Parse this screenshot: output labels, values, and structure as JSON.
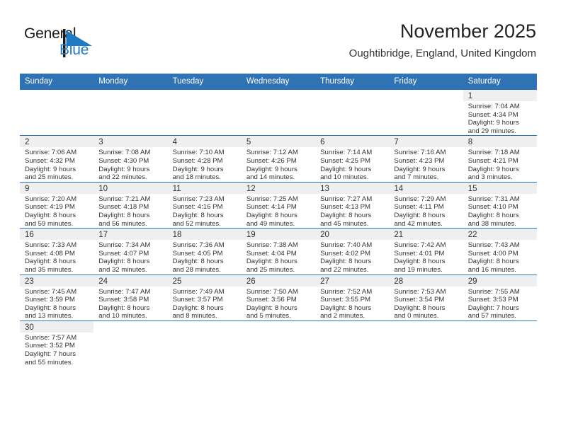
{
  "brand": {
    "name_part1": "General",
    "name_part2": "Blue",
    "logo_icon": "triangle-flag-icon",
    "accent_color": "#1f7ac4"
  },
  "header": {
    "title": "November 2025",
    "subtitle": "Oughtibridge, England, United Kingdom"
  },
  "theme": {
    "header_bg": "#2f73b5",
    "daynum_bg": "#efefef",
    "row_divider": "#2f73b5",
    "text": "#333333"
  },
  "weekday_headers": [
    "Sunday",
    "Monday",
    "Tuesday",
    "Wednesday",
    "Thursday",
    "Friday",
    "Saturday"
  ],
  "labels": {
    "sunrise_prefix": "Sunrise:",
    "sunset_prefix": "Sunset:",
    "daylight_prefix": "Daylight:"
  },
  "weeks": [
    [
      {
        "day": "",
        "blank": true
      },
      {
        "day": "",
        "blank": true
      },
      {
        "day": "",
        "blank": true
      },
      {
        "day": "",
        "blank": true
      },
      {
        "day": "",
        "blank": true
      },
      {
        "day": "",
        "blank": true
      },
      {
        "day": "1",
        "sunrise": "Sunrise: 7:04 AM",
        "sunset": "Sunset: 4:34 PM",
        "daylight_line1": "Daylight: 9 hours",
        "daylight_line2": "and 29 minutes."
      }
    ],
    [
      {
        "day": "2",
        "sunrise": "Sunrise: 7:06 AM",
        "sunset": "Sunset: 4:32 PM",
        "daylight_line1": "Daylight: 9 hours",
        "daylight_line2": "and 25 minutes."
      },
      {
        "day": "3",
        "sunrise": "Sunrise: 7:08 AM",
        "sunset": "Sunset: 4:30 PM",
        "daylight_line1": "Daylight: 9 hours",
        "daylight_line2": "and 22 minutes."
      },
      {
        "day": "4",
        "sunrise": "Sunrise: 7:10 AM",
        "sunset": "Sunset: 4:28 PM",
        "daylight_line1": "Daylight: 9 hours",
        "daylight_line2": "and 18 minutes."
      },
      {
        "day": "5",
        "sunrise": "Sunrise: 7:12 AM",
        "sunset": "Sunset: 4:26 PM",
        "daylight_line1": "Daylight: 9 hours",
        "daylight_line2": "and 14 minutes."
      },
      {
        "day": "6",
        "sunrise": "Sunrise: 7:14 AM",
        "sunset": "Sunset: 4:25 PM",
        "daylight_line1": "Daylight: 9 hours",
        "daylight_line2": "and 10 minutes."
      },
      {
        "day": "7",
        "sunrise": "Sunrise: 7:16 AM",
        "sunset": "Sunset: 4:23 PM",
        "daylight_line1": "Daylight: 9 hours",
        "daylight_line2": "and 7 minutes."
      },
      {
        "day": "8",
        "sunrise": "Sunrise: 7:18 AM",
        "sunset": "Sunset: 4:21 PM",
        "daylight_line1": "Daylight: 9 hours",
        "daylight_line2": "and 3 minutes."
      }
    ],
    [
      {
        "day": "9",
        "sunrise": "Sunrise: 7:20 AM",
        "sunset": "Sunset: 4:19 PM",
        "daylight_line1": "Daylight: 8 hours",
        "daylight_line2": "and 59 minutes."
      },
      {
        "day": "10",
        "sunrise": "Sunrise: 7:21 AM",
        "sunset": "Sunset: 4:18 PM",
        "daylight_line1": "Daylight: 8 hours",
        "daylight_line2": "and 56 minutes."
      },
      {
        "day": "11",
        "sunrise": "Sunrise: 7:23 AM",
        "sunset": "Sunset: 4:16 PM",
        "daylight_line1": "Daylight: 8 hours",
        "daylight_line2": "and 52 minutes."
      },
      {
        "day": "12",
        "sunrise": "Sunrise: 7:25 AM",
        "sunset": "Sunset: 4:14 PM",
        "daylight_line1": "Daylight: 8 hours",
        "daylight_line2": "and 49 minutes."
      },
      {
        "day": "13",
        "sunrise": "Sunrise: 7:27 AM",
        "sunset": "Sunset: 4:13 PM",
        "daylight_line1": "Daylight: 8 hours",
        "daylight_line2": "and 45 minutes."
      },
      {
        "day": "14",
        "sunrise": "Sunrise: 7:29 AM",
        "sunset": "Sunset: 4:11 PM",
        "daylight_line1": "Daylight: 8 hours",
        "daylight_line2": "and 42 minutes."
      },
      {
        "day": "15",
        "sunrise": "Sunrise: 7:31 AM",
        "sunset": "Sunset: 4:10 PM",
        "daylight_line1": "Daylight: 8 hours",
        "daylight_line2": "and 38 minutes."
      }
    ],
    [
      {
        "day": "16",
        "sunrise": "Sunrise: 7:33 AM",
        "sunset": "Sunset: 4:08 PM",
        "daylight_line1": "Daylight: 8 hours",
        "daylight_line2": "and 35 minutes."
      },
      {
        "day": "17",
        "sunrise": "Sunrise: 7:34 AM",
        "sunset": "Sunset: 4:07 PM",
        "daylight_line1": "Daylight: 8 hours",
        "daylight_line2": "and 32 minutes."
      },
      {
        "day": "18",
        "sunrise": "Sunrise: 7:36 AM",
        "sunset": "Sunset: 4:05 PM",
        "daylight_line1": "Daylight: 8 hours",
        "daylight_line2": "and 28 minutes."
      },
      {
        "day": "19",
        "sunrise": "Sunrise: 7:38 AM",
        "sunset": "Sunset: 4:04 PM",
        "daylight_line1": "Daylight: 8 hours",
        "daylight_line2": "and 25 minutes."
      },
      {
        "day": "20",
        "sunrise": "Sunrise: 7:40 AM",
        "sunset": "Sunset: 4:02 PM",
        "daylight_line1": "Daylight: 8 hours",
        "daylight_line2": "and 22 minutes."
      },
      {
        "day": "21",
        "sunrise": "Sunrise: 7:42 AM",
        "sunset": "Sunset: 4:01 PM",
        "daylight_line1": "Daylight: 8 hours",
        "daylight_line2": "and 19 minutes."
      },
      {
        "day": "22",
        "sunrise": "Sunrise: 7:43 AM",
        "sunset": "Sunset: 4:00 PM",
        "daylight_line1": "Daylight: 8 hours",
        "daylight_line2": "and 16 minutes."
      }
    ],
    [
      {
        "day": "23",
        "sunrise": "Sunrise: 7:45 AM",
        "sunset": "Sunset: 3:59 PM",
        "daylight_line1": "Daylight: 8 hours",
        "daylight_line2": "and 13 minutes."
      },
      {
        "day": "24",
        "sunrise": "Sunrise: 7:47 AM",
        "sunset": "Sunset: 3:58 PM",
        "daylight_line1": "Daylight: 8 hours",
        "daylight_line2": "and 10 minutes."
      },
      {
        "day": "25",
        "sunrise": "Sunrise: 7:49 AM",
        "sunset": "Sunset: 3:57 PM",
        "daylight_line1": "Daylight: 8 hours",
        "daylight_line2": "and 8 minutes."
      },
      {
        "day": "26",
        "sunrise": "Sunrise: 7:50 AM",
        "sunset": "Sunset: 3:56 PM",
        "daylight_line1": "Daylight: 8 hours",
        "daylight_line2": "and 5 minutes."
      },
      {
        "day": "27",
        "sunrise": "Sunrise: 7:52 AM",
        "sunset": "Sunset: 3:55 PM",
        "daylight_line1": "Daylight: 8 hours",
        "daylight_line2": "and 2 minutes."
      },
      {
        "day": "28",
        "sunrise": "Sunrise: 7:53 AM",
        "sunset": "Sunset: 3:54 PM",
        "daylight_line1": "Daylight: 8 hours",
        "daylight_line2": "and 0 minutes."
      },
      {
        "day": "29",
        "sunrise": "Sunrise: 7:55 AM",
        "sunset": "Sunset: 3:53 PM",
        "daylight_line1": "Daylight: 7 hours",
        "daylight_line2": "and 57 minutes."
      }
    ],
    [
      {
        "day": "30",
        "sunrise": "Sunrise: 7:57 AM",
        "sunset": "Sunset: 3:52 PM",
        "daylight_line1": "Daylight: 7 hours",
        "daylight_line2": "and 55 minutes."
      },
      {
        "day": "",
        "blank": true
      },
      {
        "day": "",
        "blank": true
      },
      {
        "day": "",
        "blank": true
      },
      {
        "day": "",
        "blank": true
      },
      {
        "day": "",
        "blank": true
      },
      {
        "day": "",
        "blank": true
      }
    ]
  ]
}
